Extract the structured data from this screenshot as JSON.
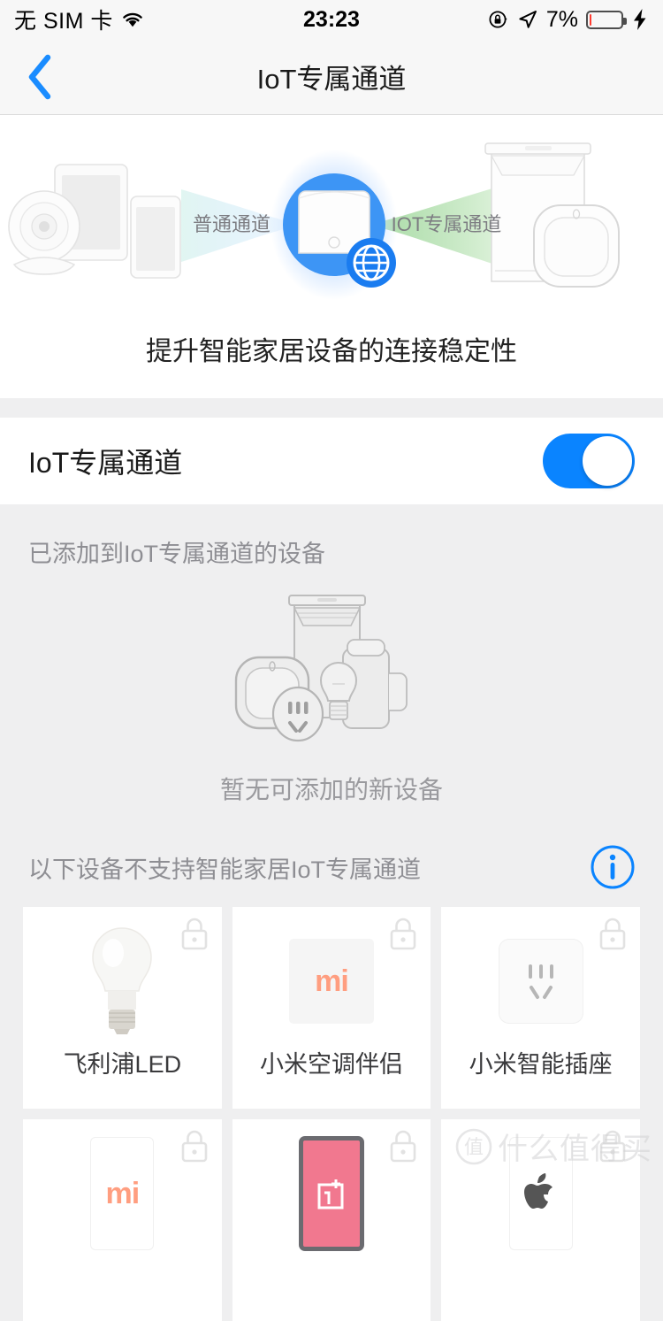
{
  "status_bar": {
    "carrier": "无 SIM 卡",
    "wifi_icon": "wifi-icon",
    "time": "23:23",
    "rotation_lock_icon": "rotation-lock-icon",
    "location_icon": "location-arrow-icon",
    "battery_percent": "7%",
    "battery_level": 7,
    "charging_icon": "lightning-bolt-icon"
  },
  "nav": {
    "back_icon": "chevron-left-icon",
    "title": "IoT专属通道"
  },
  "hero": {
    "left_channel_label": "普通通道",
    "right_channel_label": "IOT专属通道",
    "globe_icon": "globe-icon",
    "caption": "提升智能家居设备的连接稳定性"
  },
  "toggle_section": {
    "label": "IoT专属通道",
    "enabled": true
  },
  "added_section": {
    "title": "已添加到IoT专属通道的设备",
    "empty_text": "暂无可添加的新设备"
  },
  "unsupported_section": {
    "title": "以下设备不支持智能家居IoT专属通道",
    "info_icon": "info-circle-icon",
    "lock_icon": "lock-icon",
    "devices": [
      {
        "label": "飞利浦LED",
        "thumb": "lightbulb-image"
      },
      {
        "label": "小米空调伴侣",
        "thumb": "mi-logo-tile",
        "logo_text": "mi"
      },
      {
        "label": "小米智能插座",
        "thumb": "power-socket-tile"
      },
      {
        "label": "",
        "thumb": "mi-phone-tile",
        "logo_text": "mi"
      },
      {
        "label": "",
        "thumb": "oneplus-phone-tile",
        "logo_text": "1+"
      },
      {
        "label": "",
        "thumb": "apple-device-tile"
      }
    ]
  },
  "watermark": {
    "logo_text": "值",
    "text": "什么值得买"
  },
  "colors": {
    "accent_blue": "#0a84ff",
    "page_bg": "#efeff0",
    "card_bg": "#ffffff",
    "muted_text": "#8e8e93",
    "battery_red": "#ff3b30",
    "mi_orange": "#ff9e80",
    "oneplus_pink": "#f1788f"
  }
}
